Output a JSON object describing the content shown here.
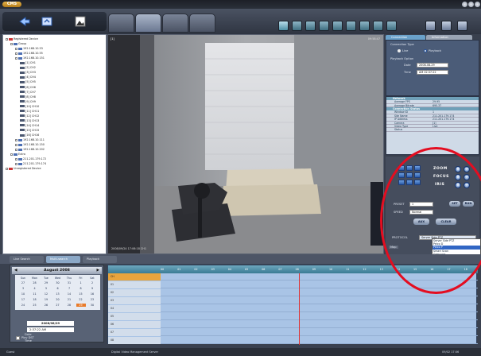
{
  "app": {
    "logo": "CMS",
    "status_left": "Guest",
    "status_center": "Digital Video Management Server",
    "status_right": "09/02 17:06"
  },
  "tree": {
    "nodes": [
      {
        "label": "Registered Device",
        "type": "red",
        "indent": 0
      },
      {
        "label": "Group",
        "type": "grp",
        "indent": 1
      },
      {
        "label": "192.168.10.53",
        "type": "dev",
        "indent": 2
      },
      {
        "label": "192.168.10.55",
        "type": "dev",
        "indent": 2
      },
      {
        "label": "192.168.10.151",
        "type": "dev",
        "indent": 2
      },
      {
        "label": "[1] CH1",
        "type": "cam",
        "indent": 3
      },
      {
        "label": "[2] CH2",
        "type": "cam",
        "indent": 3
      },
      {
        "label": "[3] CH3",
        "type": "cam",
        "indent": 3
      },
      {
        "label": "[4] CH4",
        "type": "cam",
        "indent": 3
      },
      {
        "label": "[5] CH5",
        "type": "cam",
        "indent": 3
      },
      {
        "label": "[6] CH6",
        "type": "cam",
        "indent": 3
      },
      {
        "label": "[7] CH7",
        "type": "cam",
        "indent": 3
      },
      {
        "label": "[8] CH8",
        "type": "cam",
        "indent": 3
      },
      {
        "label": "[9] CH9",
        "type": "cam",
        "indent": 3
      },
      {
        "label": "[10] CH10",
        "type": "cam",
        "indent": 3
      },
      {
        "label": "[11] CH11",
        "type": "cam",
        "indent": 3
      },
      {
        "label": "[12] CH12",
        "type": "cam",
        "indent": 3
      },
      {
        "label": "[13] CH13",
        "type": "cam",
        "indent": 3
      },
      {
        "label": "[14] CH14",
        "type": "cam",
        "indent": 3
      },
      {
        "label": "[15] CH15",
        "type": "cam",
        "indent": 3
      },
      {
        "label": "[16] CH16",
        "type": "cam",
        "indent": 3
      },
      {
        "label": "192.168.10.111",
        "type": "dev",
        "indent": 2
      },
      {
        "label": "192.168.10.150",
        "type": "dev",
        "indent": 2
      },
      {
        "label": "192.168.10.202",
        "type": "dev",
        "indent": 2
      },
      {
        "label": "Extra",
        "type": "grp",
        "indent": 1
      },
      {
        "label": "211.201.179.172",
        "type": "dev",
        "indent": 2
      },
      {
        "label": "211.201.179.174",
        "type": "dev",
        "indent": 2
      },
      {
        "label": "Unregistered Device",
        "type": "red",
        "indent": 0
      }
    ]
  },
  "video": {
    "label": "[1]",
    "time": "09:58:47",
    "bottom": "2008/09/24 17:06:18  CH1"
  },
  "panel": {
    "tab_connection": "Connection",
    "tab_information": "Information",
    "connection_type": "Connection Type",
    "live": "Live",
    "playback": "Playback",
    "playback_option": "Playback Option",
    "date_label": "Date",
    "date_value": "2008-08-29",
    "time_label": "Time",
    "time_value": "AM 02:37:22",
    "network": "Network",
    "avg_fps_label": "Average FPS",
    "avg_fps": "29.95",
    "avg_bitrate_label": "Average Bitrate",
    "avg_bitrate": "695.37",
    "conn_status": "Connection Status",
    "window_id_label": "Window ID",
    "window_id": "1",
    "site_name_label": "Site Name",
    "site_name": "211.201.179.174",
    "ip_label": "IP Address",
    "ip": "211.201.179.174",
    "camera_label": "Camera",
    "camera": "[1]",
    "video_type_label": "Video Type",
    "video_type": "Live",
    "status_label": "Status",
    "zoom": "ZOOM",
    "focus": "FOCUS",
    "iris": "IRIS",
    "preset_label": "PRESET",
    "preset_value": "1",
    "set": "SET",
    "run": "RUN",
    "speed_label": "SPEED",
    "speed_value": "Normal",
    "aux": "AUX",
    "clear": "CLEAR",
    "protocol_label": "PROTOCOL",
    "protocol_value": "Server Side PTZ",
    "map_label": "Map",
    "protocols": [
      "Server Side PTZ",
      "Pelco D",
      "Pelco P",
      "Smart Scan",
      "Samsung",
      "CNB-10",
      "Panasonic",
      "Philips 10"
    ]
  },
  "bottom": {
    "tabs": [
      "Live Search",
      "Multi-search",
      "Playback"
    ],
    "calendar_title": "August 2008",
    "weekdays": [
      "Sun",
      "Mon",
      "Tue",
      "Wed",
      "Thu",
      "Fri",
      "Sat"
    ],
    "days": [
      "27",
      "28",
      "29",
      "30",
      "31",
      "1",
      "2",
      "3",
      "4",
      "5",
      "6",
      "7",
      "8",
      "9",
      "10",
      "11",
      "12",
      "13",
      "14",
      "15",
      "16",
      "17",
      "18",
      "19",
      "20",
      "21",
      "22",
      "23",
      "24",
      "25",
      "26",
      "27",
      "28",
      "29",
      "30"
    ],
    "date_label": "Date",
    "date_value": "2008/08/29",
    "time_label": "Time",
    "time_value": "2:37:22 AM",
    "play_dst": "Play DST",
    "hours": [
      "00",
      "01",
      "02",
      "03",
      "04",
      "05",
      "06",
      "07",
      "08",
      "09",
      "10",
      "11",
      "12",
      "13",
      "14",
      "15",
      "16",
      "17",
      "18"
    ],
    "channels": [
      "CH",
      "01",
      "02",
      "03",
      "04",
      "05",
      "06",
      "07",
      "08"
    ]
  }
}
